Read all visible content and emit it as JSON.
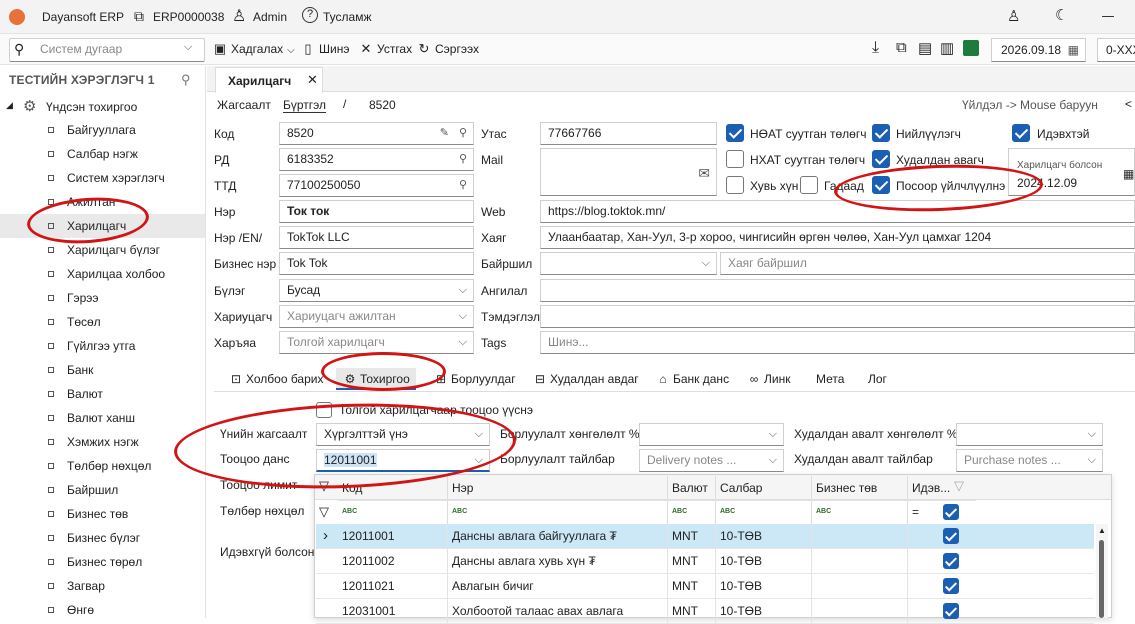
{
  "title_bar": {
    "app": "Dayansoft ERP",
    "doc": "ERP0000038",
    "user": "Admin",
    "help": "Тусламж"
  },
  "toolbar": {
    "search_placeholder": "Систем дугаар",
    "save": "Хадгалах",
    "new": "Шинэ",
    "close": "Устгах",
    "refresh": "Сэргээх",
    "date": "2026.09.18",
    "extra": "0-XXX"
  },
  "sidebar": {
    "user": "ТЕСТИЙН ХЭРЭГЛЭГЧ 1",
    "root": "Үндсэн тохиргоо",
    "items": [
      "Байгууллага",
      "Салбар нэгж",
      "Систем хэрэглэгч",
      "Ажилтан",
      "Харилцагч",
      "Харилцагч бүлэг",
      "Харилцаа холбоо",
      "Гэрээ",
      "Төсөл",
      "Гүйлгээ утга",
      "Банк",
      "Валют",
      "Валют ханш",
      "Хэмжих нэгж",
      "Төлбөр нөхцөл",
      "Байршил",
      "Бизнес төв",
      "Бизнес бүлэг",
      "Бизнес төрөл",
      "Загвар",
      "Өнгө"
    ]
  },
  "doc_tab": "Харилцагч",
  "breadcrumb": {
    "a": "Жагсаалт",
    "b": "Бүртгэл",
    "sep": "/",
    "num": "8520",
    "hint": "Үйлдэл -> Mouse баруун",
    "hint2": "<"
  },
  "form": {
    "code_l": "Код",
    "code": "8520",
    "rd_l": "РД",
    "rd": "6183352",
    "ttd_l": "ТТД",
    "ttd": "77100250050",
    "name_l": "Нэр",
    "name": "Ток ток",
    "name_en_l": "Нэр /EN/",
    "name_en": "TokTok LLC",
    "biz_l": "Бизнес нэр",
    "biz": "Tok Tok",
    "group_l": "Бүлэг",
    "group": "Бусад",
    "resp_l": "Хариуцагч",
    "resp_ph": "Хариуцагч ажилтан",
    "parent_l": "Харъяа",
    "parent_ph": "Толгой харилцагч",
    "phone_l": "Утас",
    "phone": "77667766",
    "mail_l": "Mail",
    "web_l": "Web",
    "web": "https://blog.toktok.mn/",
    "addr_l": "Хаяг",
    "addr": "Улаанбаатар, Хан-Уул, 3-р хороо, чингисийн өргөн чөлөө, Хан-Уул цамхаг 1204",
    "loc_l": "Байршил",
    "loc_ph": "Хаяг байршил",
    "vat_l": "Ангилал",
    "note_l": "Тэмдэглэл",
    "tags_l": "Tags",
    "tags_ph": "Шинэ..."
  },
  "checks": {
    "c1": "НӨАТ суутган төлөгч",
    "c2": "Нийлүүлэгч",
    "c3": "Идэвхтэй",
    "c4": "НХАТ суутган төлөгч",
    "c5": "Худалдан авагч",
    "c6": "Хувь хүн",
    "c7": "Гадаад",
    "c8": "Посоор үйлчлүүлнэ",
    "since_l": "Харилцагч болсон",
    "since": "2024.12.09"
  },
  "tabs": [
    "Холбоо барих",
    "Тохиргоо",
    "Борлуулдаг",
    "Худалдан авдаг",
    "Банк данс",
    "Линк",
    "Мета",
    "Лог"
  ],
  "settings": {
    "parent_chk": "Толгой харилцагчаар тооцоо үүснэ",
    "price_l": "Үнийн жагсаалт",
    "price": "Хүргэлттэй үнэ",
    "acc_l": "Тооцоо данс",
    "acc": "12011001",
    "limit_l": "Тооцоо лимит",
    "pay_l": "Төлбөр нөхцөл",
    "inactive_l": "Идэвхгүй болсон",
    "sale_disc_l": "Борлуулалт хөнгөлөлт %",
    "sale_note_l": "Борлуулалт тайлбар",
    "sale_note_ph": "Delivery notes ...",
    "buy_disc_l": "Худалдан авалт хөнгөлөлт %",
    "buy_note_l": "Худалдан авалт тайлбар",
    "buy_note_ph": "Purchase notes ..."
  },
  "grid": {
    "cols": [
      "Код",
      "Нэр",
      "Валют",
      "Салбар",
      "Бизнес төв",
      "Идэв..."
    ],
    "filter_eq": "=",
    "rows": [
      {
        "code": "12011001",
        "name": "Дансны авлага байгууллага ₮",
        "cur": "MNT",
        "br": "10-ТӨВ"
      },
      {
        "code": "12011002",
        "name": "Дансны авлага хувь хүн ₮",
        "cur": "MNT",
        "br": "10-ТӨВ"
      },
      {
        "code": "12011021",
        "name": "Авлагын бичиг",
        "cur": "MNT",
        "br": "10-ТӨВ"
      },
      {
        "code": "12031001",
        "name": "Холбоотой талаас авах авлага",
        "cur": "MNT",
        "br": "10-ТӨВ"
      }
    ]
  },
  "colors": {
    "accent": "#1a5fb4",
    "annotation": "#d21414",
    "selected_row": "#cce8f6"
  }
}
